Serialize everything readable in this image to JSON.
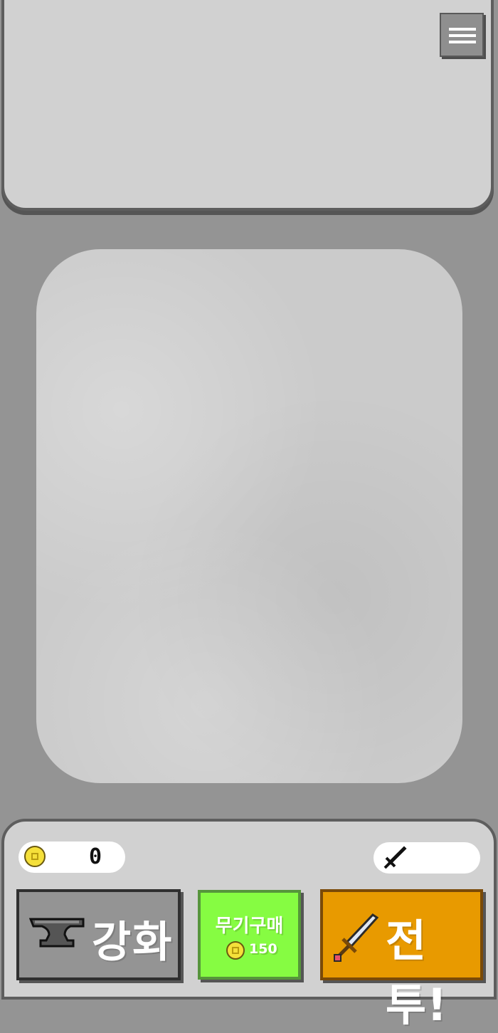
{
  "header": {
    "menu_icon": "hamburger-menu-icon"
  },
  "status": {
    "coins": "0",
    "coin_icon": "gold-coin-icon",
    "weapon_icon": "sword-icon",
    "weapon_name": ""
  },
  "actions": {
    "upgrade": {
      "label": "강화",
      "icon": "anvil-icon"
    },
    "buy_weapon": {
      "label": "무기구매",
      "price": "150",
      "icon": "gold-coin-icon"
    },
    "battle": {
      "label": "전투!",
      "icon": "sword-icon"
    }
  },
  "colors": {
    "background": "#949494",
    "panel": "#d1d1d1",
    "buy_button": "#86fc42",
    "battle_button": "#e89a00",
    "upgrade_button": "#949494"
  }
}
